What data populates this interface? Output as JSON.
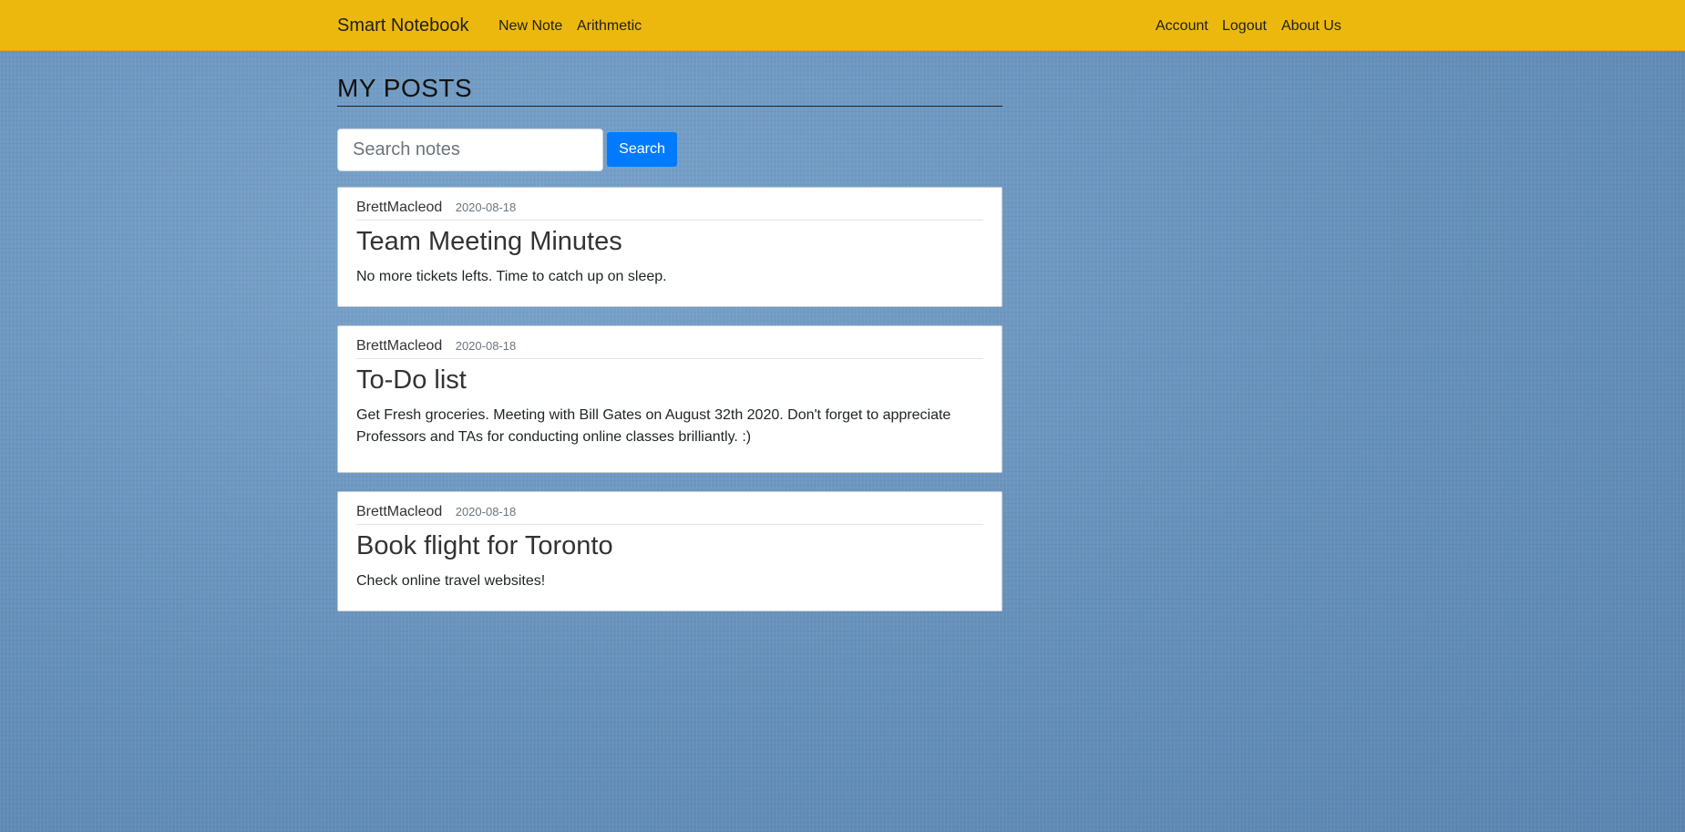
{
  "navbar": {
    "brand": "Smart Notebook",
    "left_links": [
      "New Note",
      "Arithmetic"
    ],
    "right_links": [
      "Account",
      "Logout",
      "About Us"
    ],
    "background_color": "#ecb80d"
  },
  "page": {
    "title": "MY POSTS"
  },
  "search": {
    "placeholder": "Search notes",
    "value": "",
    "button_label": "Search",
    "button_color": "#007bff"
  },
  "posts": [
    {
      "author": "BrettMacleod",
      "date": "2020-08-18",
      "title": "Team Meeting Minutes",
      "content": "No more tickets lefts. Time to catch up on sleep."
    },
    {
      "author": "BrettMacleod",
      "date": "2020-08-18",
      "title": "To-Do list",
      "content": "Get Fresh groceries. Meeting with Bill Gates on August 32th 2020. Don't forget to appreciate Professors and TAs for conducting online classes brilliantly. :)"
    },
    {
      "author": "BrettMacleod",
      "date": "2020-08-18",
      "title": "Book flight for Toronto",
      "content": "Check online travel websites!"
    }
  ]
}
